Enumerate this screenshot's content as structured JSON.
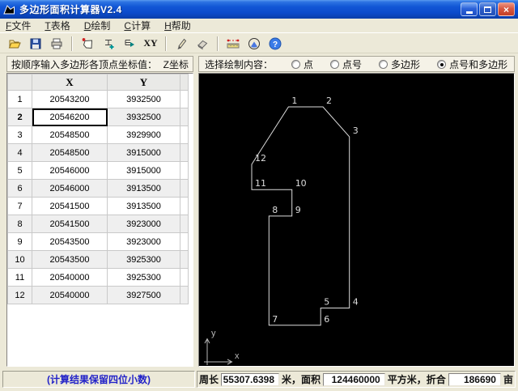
{
  "window": {
    "title": "多边形面积计算器V2.4",
    "controls": {
      "minimize": "minimize",
      "maximize": "maximize",
      "close": "×"
    }
  },
  "menu": {
    "items": [
      {
        "hotkey": "F",
        "label": "文件"
      },
      {
        "hotkey": "T",
        "label": "表格"
      },
      {
        "hotkey": "D",
        "label": "绘制"
      },
      {
        "hotkey": "C",
        "label": "计算"
      },
      {
        "hotkey": "H",
        "label": "帮助"
      }
    ]
  },
  "toolbar": {
    "icons": [
      "open",
      "save",
      "print",
      "new-polygon",
      "insert-row",
      "move-row",
      "xy-input",
      "draw-pen",
      "eraser",
      "measure-length",
      "measure-area",
      "help"
    ],
    "xy_label": "XY"
  },
  "left_panel": {
    "header_label": "按顺序输入多边形各顶点坐标值：",
    "z_button_label": "Z坐标",
    "table": {
      "columns": [
        "X",
        "Y"
      ],
      "selected": {
        "row": 2,
        "col": "X"
      },
      "rows": [
        {
          "n": 1,
          "x": "20543200",
          "y": "3932500"
        },
        {
          "n": 2,
          "x": "20546200",
          "y": "3932500"
        },
        {
          "n": 3,
          "x": "20548500",
          "y": "3929900"
        },
        {
          "n": 4,
          "x": "20548500",
          "y": "3915000"
        },
        {
          "n": 5,
          "x": "20546000",
          "y": "3915000"
        },
        {
          "n": 6,
          "x": "20546000",
          "y": "3913500"
        },
        {
          "n": 7,
          "x": "20541500",
          "y": "3913500"
        },
        {
          "n": 8,
          "x": "20541500",
          "y": "3923000"
        },
        {
          "n": 9,
          "x": "20543500",
          "y": "3923000"
        },
        {
          "n": 10,
          "x": "20543500",
          "y": "3925300"
        },
        {
          "n": 11,
          "x": "20540000",
          "y": "3925300"
        },
        {
          "n": 12,
          "x": "20540000",
          "y": "3927500"
        }
      ]
    }
  },
  "right_panel": {
    "draw_options_label": "选择绘制内容：",
    "options": [
      {
        "label": "点",
        "selected": false
      },
      {
        "label": "点号",
        "selected": false
      },
      {
        "label": "多边形",
        "selected": false
      },
      {
        "label": "点号和多边形",
        "selected": true
      }
    ],
    "canvas": {
      "axis_x_label": "x",
      "axis_y_label": "y",
      "polygon_color": "#DCDCDC",
      "background": "#000000"
    }
  },
  "status_bar": {
    "note": "(计算结果保留四位小数)",
    "perimeter_label": "周长",
    "perimeter_value": "55307.6398",
    "perimeter_unit": "米，面积",
    "area_value": "124460000",
    "area_unit": "平方米，折合",
    "mu_value": "186690",
    "mu_unit": "亩"
  }
}
